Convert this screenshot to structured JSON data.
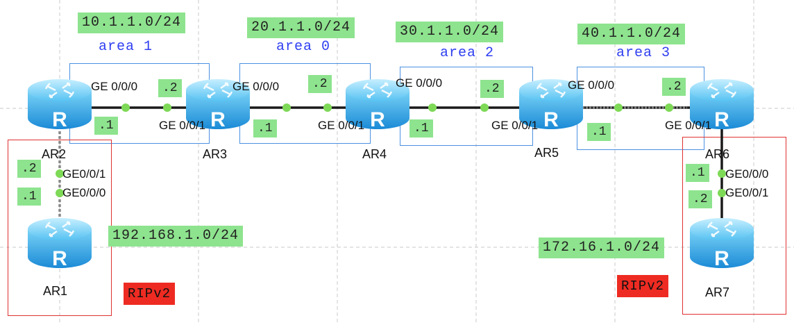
{
  "networks": {
    "net10": "10.1.1.0/24",
    "net20": "20.1.1.0/24",
    "net30": "30.1.1.0/24",
    "net40": "40.1.1.0/24",
    "net192": "192.168.1.0/24",
    "net172": "172.16.1.0/24"
  },
  "areas": {
    "a1": "area 1",
    "a0": "area 0",
    "a2": "area 2",
    "a3": "area 3"
  },
  "routers": {
    "ar1": "AR1",
    "ar2": "AR2",
    "ar3": "AR3",
    "ar4": "AR4",
    "ar5": "AR5",
    "ar6": "AR6",
    "ar7": "AR7",
    "icon_letter": "R"
  },
  "interfaces": {
    "ge000": "GE 0/0/0",
    "ge001": "GE 0/0/1",
    "ge000_nospace": "GE0/0/0",
    "ge001_nospace": "GE0/0/1",
    "ge001_ar4": "GE 0/0/1"
  },
  "host_ips": {
    "dot1": ".1",
    "dot2": ".2"
  },
  "protocols": {
    "rip_left": "RIPv2",
    "rip_right": "RIPv2"
  },
  "colors": {
    "area_border": "#4a90e2",
    "rip_border": "#e03030",
    "label_green": "#8ee38e",
    "area_text": "#2f3ff0",
    "rip_fill": "#ee2b22",
    "link_dot": "#7ed957"
  },
  "icons": {
    "router": "router-icon"
  }
}
